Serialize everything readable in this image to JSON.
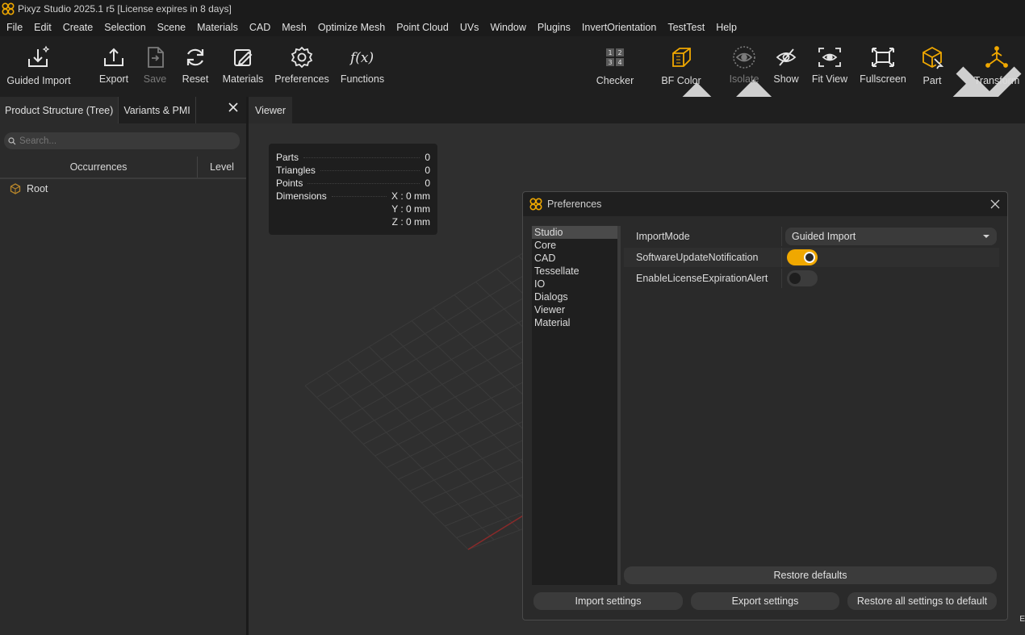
{
  "app": {
    "title": "Pixyz Studio 2025.1 r5 [License expires in 8 days]",
    "accent": "#f0a800"
  },
  "menu": [
    "File",
    "Edit",
    "Create",
    "Selection",
    "Scene",
    "Materials",
    "CAD",
    "Mesh",
    "Optimize Mesh",
    "Point Cloud",
    "UVs",
    "Window",
    "Plugins",
    "InvertOrientation",
    "TestTest",
    "Help"
  ],
  "toolbar": {
    "guided_import": "Guided Import",
    "export": "Export",
    "save": "Save",
    "reset": "Reset",
    "materials": "Materials",
    "preferences": "Preferences",
    "functions": "Functions",
    "checker": "Checker",
    "bf_color": "BF Color",
    "isolate": "Isolate",
    "show": "Show",
    "fit_view": "Fit View",
    "fullscreen": "Fullscreen",
    "part": "Part",
    "transform": "Transform",
    "checker_digits": [
      "1",
      "2",
      "3",
      "4"
    ]
  },
  "left_panel": {
    "tabs": [
      "Product Structure (Tree)",
      "Variants & PMI"
    ],
    "search_placeholder": "Search...",
    "columns": [
      "Occurrences",
      "Level"
    ],
    "tree": [
      {
        "label": "Root"
      }
    ]
  },
  "viewer": {
    "tab": "Viewer",
    "stats": {
      "parts_label": "Parts",
      "parts_value": "0",
      "triangles_label": "Triangles",
      "triangles_value": "0",
      "points_label": "Points",
      "points_value": "0",
      "dimensions_label": "Dimensions",
      "dim_x": "X : 0 mm",
      "dim_y": "Y : 0 mm",
      "dim_z": "Z : 0 mm"
    }
  },
  "preferences": {
    "title": "Preferences",
    "categories": [
      "Studio",
      "Core",
      "CAD",
      "Tessellate",
      "IO",
      "Dialogs",
      "Viewer",
      "Material"
    ],
    "selected_category": "Studio",
    "properties": {
      "import_mode_label": "ImportMode",
      "import_mode_value": "Guided Import",
      "update_notif_label": "SoftwareUpdateNotification",
      "update_notif_on": true,
      "license_alert_label": "EnableLicenseExpirationAlert",
      "license_alert_on": false
    },
    "buttons": {
      "restore_defaults": "Restore defaults",
      "import_settings": "Import settings",
      "export_settings": "Export settings",
      "restore_all": "Restore all settings to default"
    }
  },
  "edge_glyph": "E"
}
